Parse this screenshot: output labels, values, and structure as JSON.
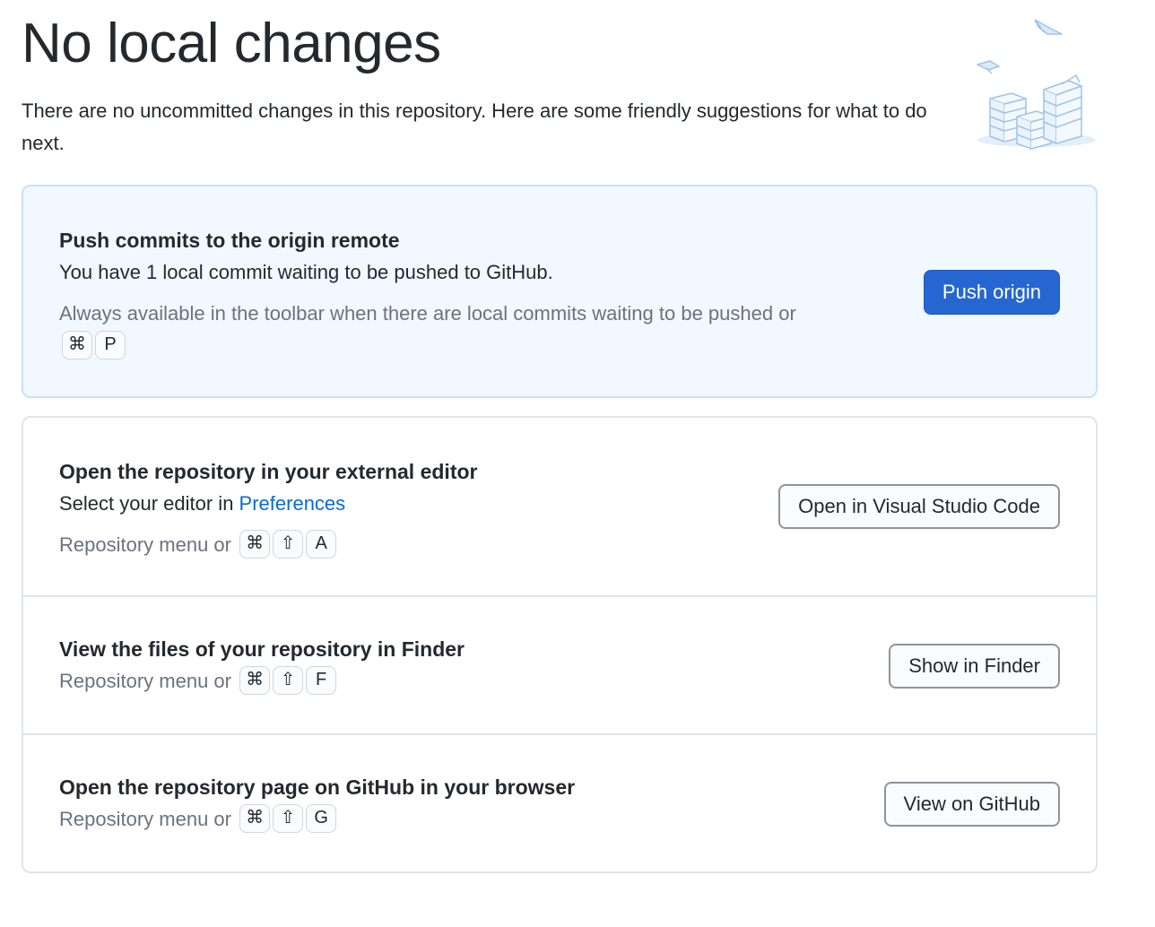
{
  "header": {
    "title": "No local changes",
    "description": "There are no uncommitted changes in this repository. Here are some friendly suggestions for what to do next."
  },
  "illustration": {
    "icon": "paper-stacks-illustration"
  },
  "push": {
    "title": "Push commits to the origin remote",
    "description": "You have 1 local commit waiting to be pushed to GitHub.",
    "hint": "Always available in the toolbar when there are local commits waiting to be pushed or",
    "keys": [
      "⌘",
      "P"
    ],
    "button": "Push origin"
  },
  "editor": {
    "title": "Open the repository in your external editor",
    "description_prefix": "Select your editor in ",
    "description_link": "Preferences",
    "hint": "Repository menu or",
    "keys": [
      "⌘",
      "⇧",
      "A"
    ],
    "button": "Open in Visual Studio Code"
  },
  "finder": {
    "title": "View the files of your repository in Finder",
    "hint": "Repository menu or",
    "keys": [
      "⌘",
      "⇧",
      "F"
    ],
    "button": "Show in Finder"
  },
  "github": {
    "title": "Open the repository page on GitHub in your browser",
    "hint": "Repository menu or",
    "keys": [
      "⌘",
      "⇧",
      "G"
    ],
    "button": "View on GitHub"
  },
  "colors": {
    "primary_button": "#2566d1",
    "link": "#0969da",
    "primary_card_bg": "#f1f8ff"
  }
}
